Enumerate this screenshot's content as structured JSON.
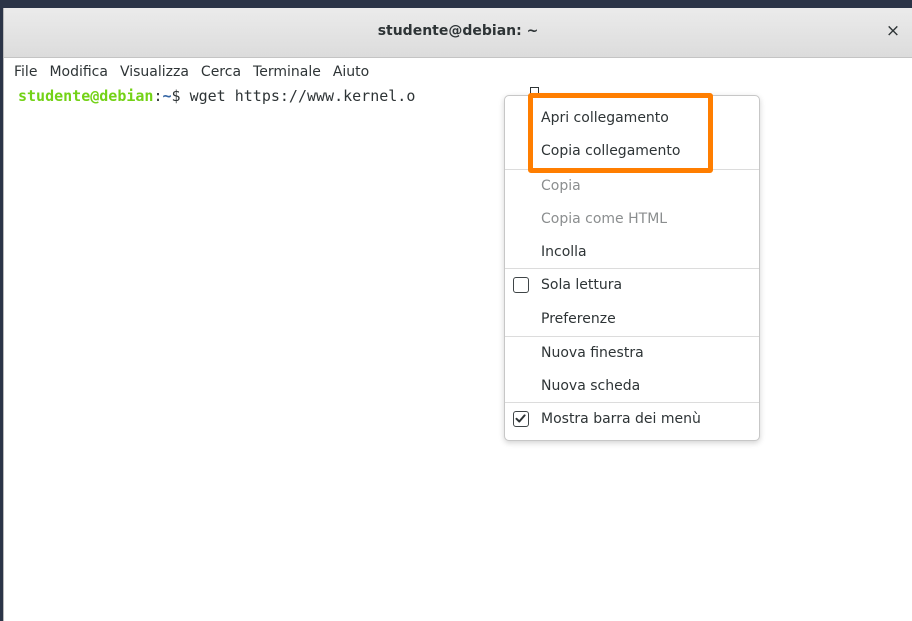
{
  "window": {
    "title": "studente@debian: ~",
    "close_glyph": "×"
  },
  "menubar": {
    "items": [
      "File",
      "Modifica",
      "Visualizza",
      "Cerca",
      "Terminale",
      "Aiuto"
    ]
  },
  "terminal": {
    "prompt_user": "studente@debian",
    "prompt_colon": ":",
    "prompt_path": "~",
    "prompt_symbol": "$ ",
    "command": "wget https://www.kernel.o"
  },
  "context_menu": {
    "items": [
      {
        "label": "Apri collegamento",
        "enabled": true
      },
      {
        "label": "Copia collegamento",
        "enabled": true
      },
      {
        "label": "Copia",
        "enabled": false
      },
      {
        "label": "Copia come HTML",
        "enabled": false
      },
      {
        "label": "Incolla",
        "enabled": true
      },
      {
        "label": "Sola lettura",
        "enabled": true,
        "checkbox": true,
        "checked": false
      },
      {
        "label": "Preferenze",
        "enabled": true
      },
      {
        "label": "Nuova finestra",
        "enabled": true
      },
      {
        "label": "Nuova scheda",
        "enabled": true
      },
      {
        "label": "Mostra barra dei menù",
        "enabled": true,
        "checkbox": true,
        "checked": true
      }
    ]
  },
  "annotation": {
    "highlight_color": "#ff7e00"
  },
  "colors": {
    "prompt_user": "#73d216",
    "prompt_path": "#3465a4",
    "text": "#2e3436",
    "disabled_text": "#8b8e8f"
  },
  "icons": {
    "close": "close-icon",
    "checkbox_unchecked": "checkbox-unchecked-icon",
    "checkbox_checked": "checkbox-checked-icon"
  }
}
